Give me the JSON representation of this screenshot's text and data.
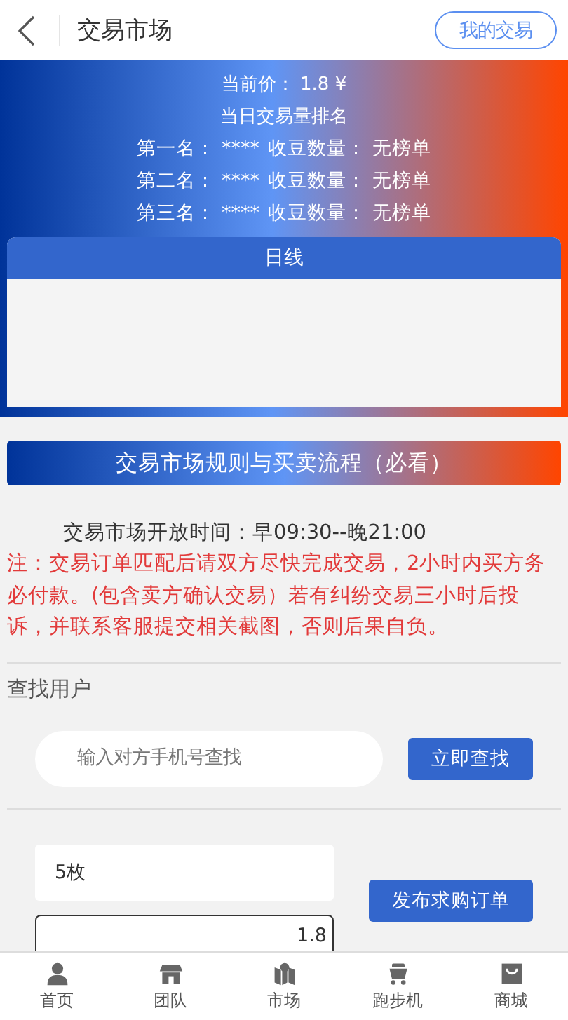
{
  "header": {
    "title": "交易市场",
    "action": "我的交易"
  },
  "banner": {
    "price": "当前价：  1.8 ¥",
    "ranking_title": "当日交易量排名",
    "ranks": [
      {
        "place": "第一名：",
        "user": "****",
        "label": "收豆数量：",
        "value": "无榜单"
      },
      {
        "place": "第二名：",
        "user": "****",
        "label": "收豆数量：",
        "value": "无榜单"
      },
      {
        "place": "第三名：",
        "user": "****",
        "label": "收豆数量：",
        "value": "无榜单"
      }
    ],
    "chart_title": "日线"
  },
  "rules": {
    "title": "交易市场规则与买卖流程（必看）",
    "hours": "交易市场开放时间：早09:30--晚21:00",
    "notice": "注：交易订单匹配后请双方尽快完成交易，2小时内买方务必付款。(包含卖方确认交易）若有纠纷交易三小时后投诉，并联系客服提交相关截图，否则后果自负。"
  },
  "find_user": {
    "heading": "查找用户",
    "placeholder": "输入对方手机号查找",
    "button": "立即查找"
  },
  "order": {
    "quantity": "5枚",
    "price": "1.8",
    "button": "发布求购订单"
  },
  "tabs": [
    {
      "label": "首页",
      "kind": "person"
    },
    {
      "label": "团队",
      "kind": "shop"
    },
    {
      "label": "市场",
      "kind": "map"
    },
    {
      "label": "跑步机",
      "kind": "cart"
    },
    {
      "label": "商城",
      "kind": "bag"
    }
  ]
}
